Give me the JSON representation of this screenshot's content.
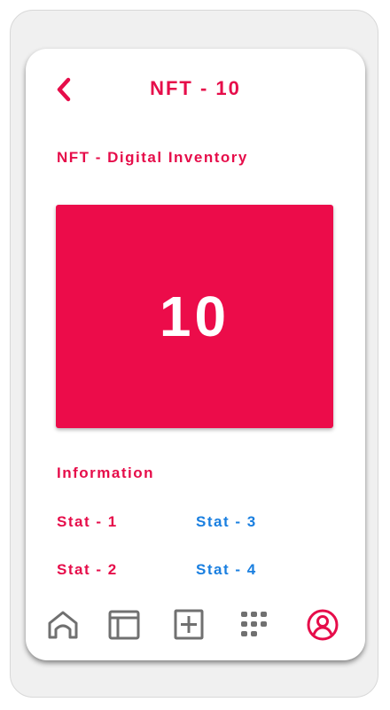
{
  "header": {
    "title": "NFT - 10",
    "back_icon": "chevron-left-icon"
  },
  "section": {
    "title": "NFT - Digital Inventory"
  },
  "card": {
    "number": "10",
    "color": "#ec0c4a"
  },
  "information": {
    "title": "Information",
    "stats": [
      {
        "label": "Stat - 1",
        "color": "#e60d4a"
      },
      {
        "label": "Stat - 2",
        "color": "#e60d4a"
      },
      {
        "label": "Stat - 3",
        "color": "#1a7fe0"
      },
      {
        "label": "Stat - 4",
        "color": "#1a7fe0"
      }
    ]
  },
  "nav": {
    "items": [
      {
        "icon": "home-icon",
        "active": false
      },
      {
        "icon": "layout-icon",
        "active": false
      },
      {
        "icon": "add-square-icon",
        "active": false
      },
      {
        "icon": "apps-grid-icon",
        "active": false
      },
      {
        "icon": "profile-icon",
        "active": true
      }
    ],
    "active_color": "#e60d4a",
    "inactive_color": "#707070"
  }
}
